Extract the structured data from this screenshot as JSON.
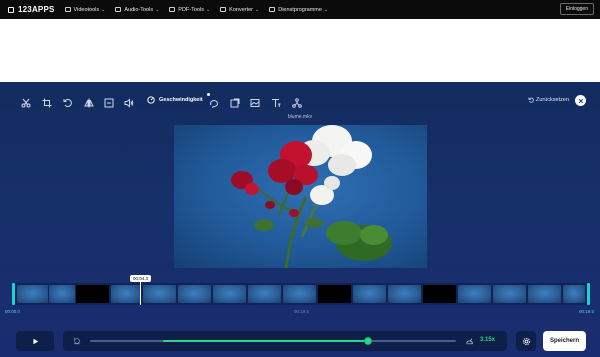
{
  "brand": {
    "name": "123APPS"
  },
  "nav": {
    "items": [
      {
        "label": "Videotools",
        "icon": "video-icon"
      },
      {
        "label": "Audio-Tools",
        "icon": "audio-icon"
      },
      {
        "label": "PDF-Tools",
        "icon": "pdf-icon"
      },
      {
        "label": "Konverter",
        "icon": "converter-icon"
      },
      {
        "label": "Dienstprogramme",
        "icon": "utilities-icon"
      }
    ],
    "login_label": "Einloggen"
  },
  "toolbar": {
    "tools": [
      {
        "name": "cut-icon"
      },
      {
        "name": "crop-icon"
      },
      {
        "name": "rotate-icon"
      },
      {
        "name": "flip-icon"
      },
      {
        "name": "resize-icon"
      },
      {
        "name": "volume-icon"
      },
      {
        "name": "speed-icon",
        "label": "Geschwindigkeit"
      },
      {
        "name": "loop-icon"
      },
      {
        "name": "stabilize-icon"
      },
      {
        "name": "image-icon"
      },
      {
        "name": "text-icon"
      },
      {
        "name": "extract-icon"
      }
    ],
    "active_label": "Geschwindigkeit",
    "reset_label": "Zurücksetzen"
  },
  "video": {
    "filename": "blume.mkv"
  },
  "timeline": {
    "playhead_label": "00:04.3",
    "time_start": "00:00.0",
    "time_mid": "00:19.5",
    "time_end": "00:19.5"
  },
  "controls": {
    "speed_value": "3.15x",
    "speed_fraction": 0.76,
    "speed_start_fraction": 0.2,
    "save_label": "Speichern"
  },
  "colors": {
    "accent": "#2bd58a",
    "editor_bg": "#16306a",
    "timeline_handle": "#19d3d3"
  }
}
